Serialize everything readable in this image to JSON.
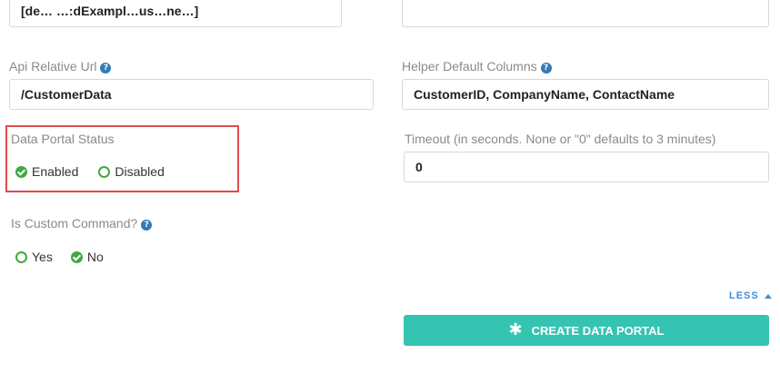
{
  "top_input": {
    "value": "[de…             …:dExampl…us…ne…]"
  },
  "api_relative_url": {
    "label": "Api Relative Url",
    "value": "/CustomerData"
  },
  "helper_default_columns": {
    "label": "Helper Default Columns",
    "value": "CustomerID, CompanyName, ContactName"
  },
  "data_portal_status": {
    "label": "Data Portal Status",
    "options": [
      {
        "label": "Enabled",
        "selected": true
      },
      {
        "label": "Disabled",
        "selected": false
      }
    ]
  },
  "timeout": {
    "label": "Timeout (in seconds. None or \"0\" defaults to 3 minutes)",
    "value": "0"
  },
  "is_custom_command": {
    "label": "Is Custom Command?",
    "options": [
      {
        "label": "Yes",
        "selected": false
      },
      {
        "label": "No",
        "selected": true
      }
    ]
  },
  "help_icon_glyph": "?",
  "less_link": {
    "label": "LESS"
  },
  "create_button": {
    "label": "CREATE DATA PORTAL",
    "icon": "asterisk-icon"
  },
  "colors": {
    "accent_teal": "#35c4b1",
    "radio_green": "#3fa93f",
    "highlight_red": "#e3494d",
    "link_blue": "#3a8fd8",
    "help_blue": "#337ab7"
  }
}
